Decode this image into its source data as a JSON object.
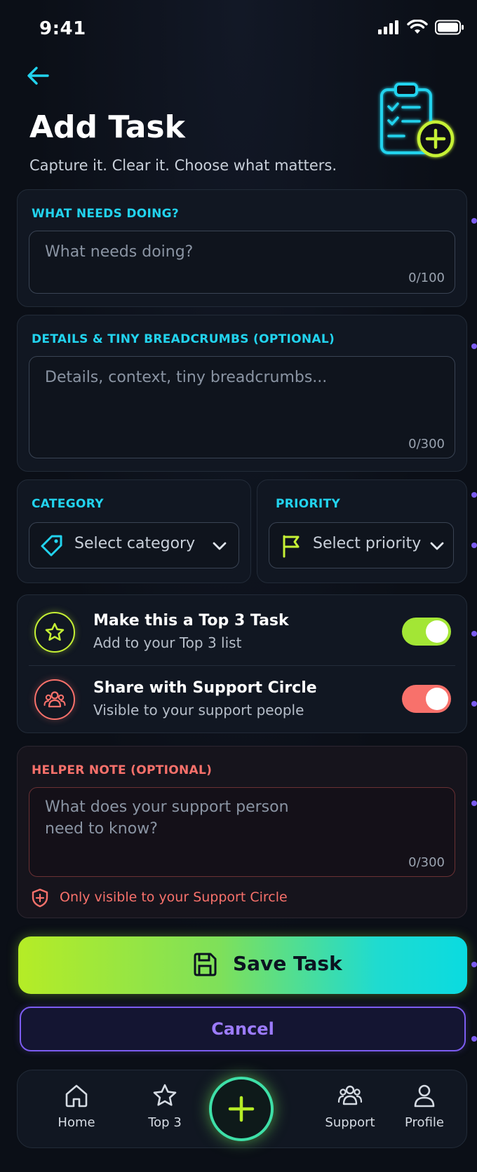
{
  "status_bar": {
    "time": "9:41"
  },
  "header": {
    "title": "Add Task",
    "subtitle": "Capture it. Clear it. Choose what matters."
  },
  "task_name": {
    "label": "WHAT NEEDS DOING?",
    "placeholder": "What needs doing?",
    "counter": "0/100"
  },
  "details": {
    "label": "DETAILS & TINY BREADCRUMBS (OPTIONAL)",
    "placeholder": "Details, context, tiny breadcrumbs...",
    "counter": "0/300"
  },
  "category": {
    "label": "CATEGORY",
    "value": "Select category"
  },
  "priority": {
    "label": "PRIORITY",
    "value": "Select priority"
  },
  "toggles": {
    "top3": {
      "title": "Make this a Top 3 Task",
      "subtitle": "Add to your Top 3 list",
      "on": true,
      "color": "#a3e635"
    },
    "support": {
      "title": "Share with Support Circle",
      "subtitle": "Visible to your support people",
      "on": true,
      "color": "#f8716b"
    }
  },
  "helper_note": {
    "label": "HELPER NOTE (OPTIONAL)",
    "placeholder_line1": "What does your support person",
    "placeholder_line2": "need to know?",
    "counter": "0/300",
    "privacy_note": "Only visible to your Support Circle"
  },
  "actions": {
    "save_label": "Save Task",
    "cancel_label": "Cancel"
  },
  "nav": {
    "items": [
      {
        "label": "Home",
        "icon": "home-icon"
      },
      {
        "label": "Top 3",
        "icon": "star-icon"
      },
      {
        "label": "Support",
        "icon": "people-icon"
      },
      {
        "label": "Profile",
        "icon": "person-icon"
      }
    ],
    "fab_icon": "plus-icon"
  },
  "colors": {
    "accent_cyan": "#22d3ee",
    "accent_lime": "#a3e635",
    "accent_coral": "#f8716b",
    "accent_purple": "#7c5cf0",
    "background": "#0b0f17"
  }
}
